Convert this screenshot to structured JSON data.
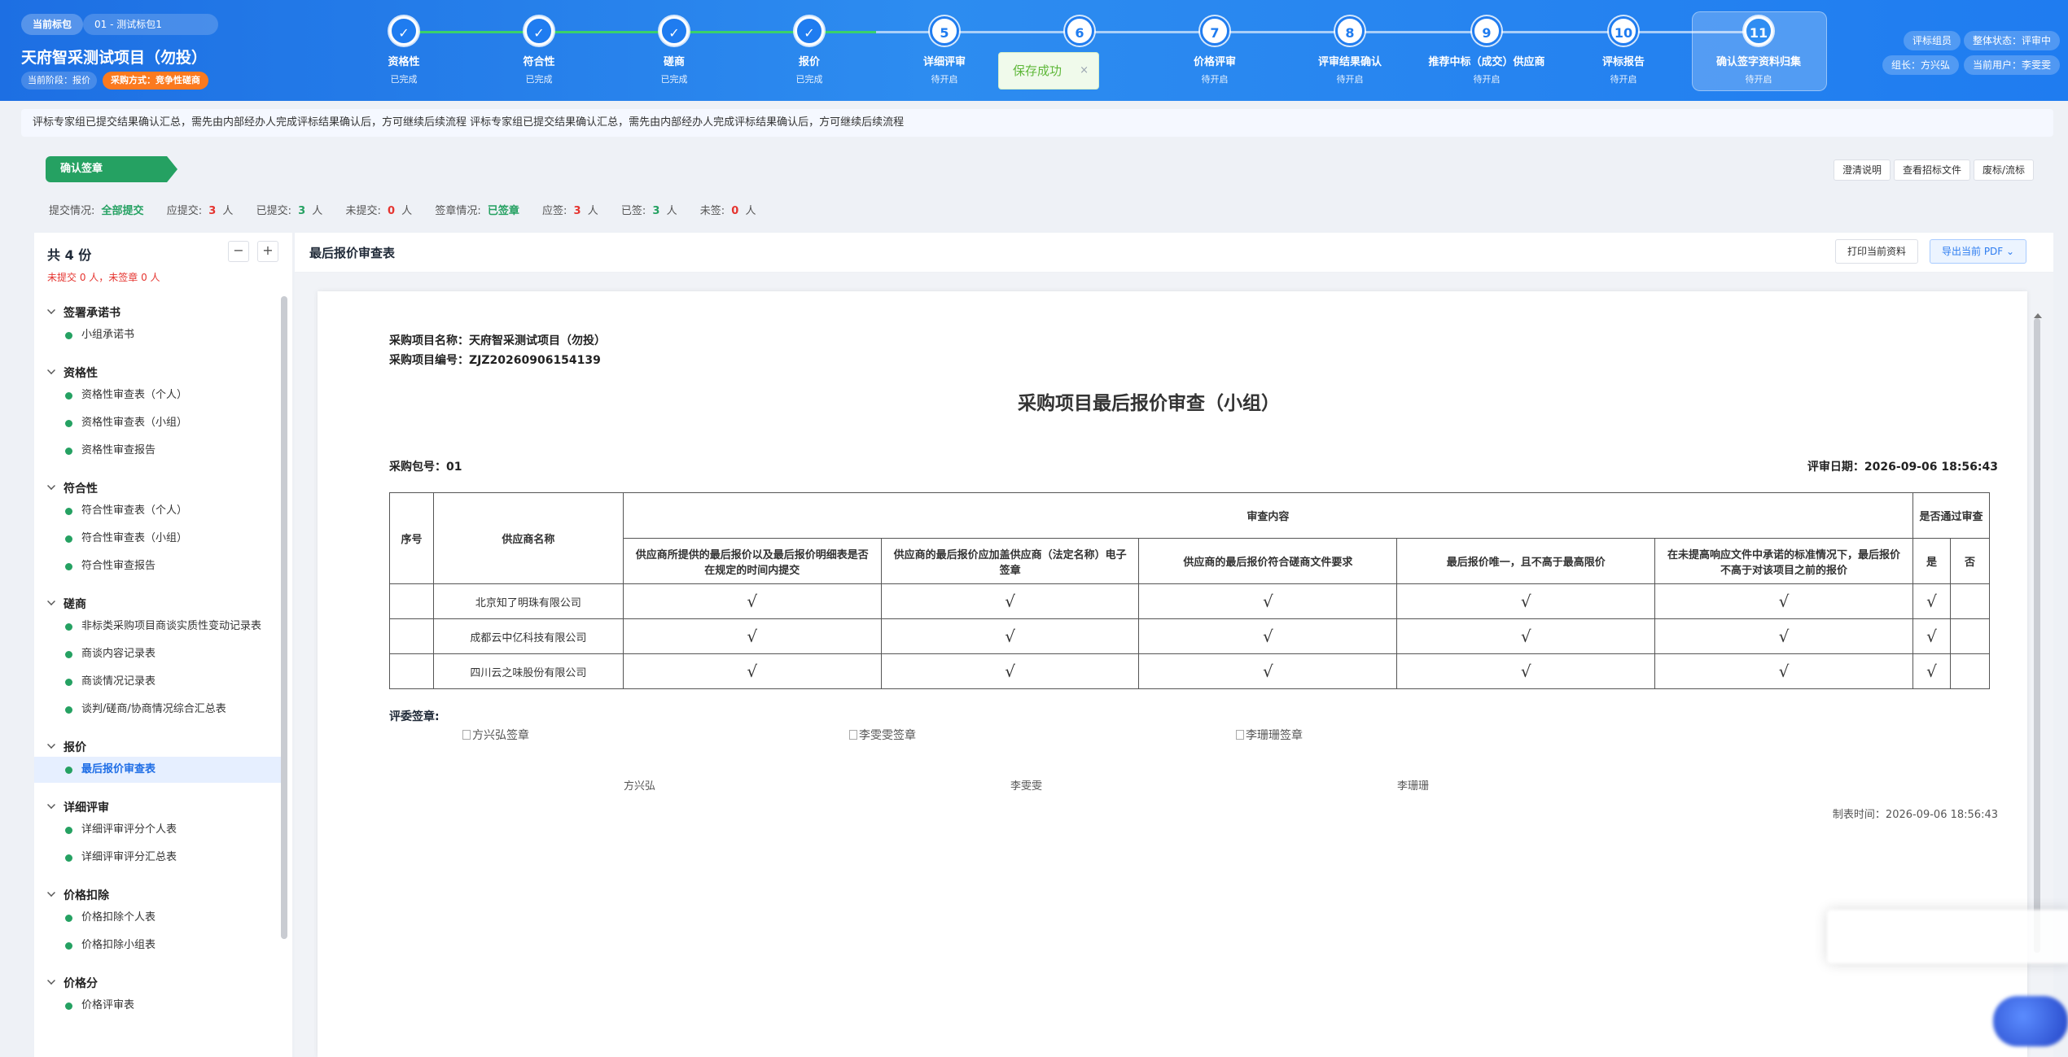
{
  "header": {
    "pkg_label": "当前标包",
    "pkg_value": "01 - 测试标包1",
    "project_title": "天府智采测试项目（勿投）",
    "stage": "当前阶段：报价",
    "method": "采购方式：竞争性磋商",
    "steps": [
      {
        "num": "✓",
        "label": "资格性",
        "status": "已完成",
        "state": "done"
      },
      {
        "num": "✓",
        "label": "符合性",
        "status": "已完成",
        "state": "done"
      },
      {
        "num": "✓",
        "label": "磋商",
        "status": "已完成",
        "state": "done"
      },
      {
        "num": "✓",
        "label": "报价",
        "status": "已完成",
        "state": "done"
      },
      {
        "num": "5",
        "label": "详细评审",
        "status": "待开启",
        "state": "todo"
      },
      {
        "num": "6",
        "label": "",
        "status": "",
        "state": "todo"
      },
      {
        "num": "7",
        "label": "价格评审",
        "status": "待开启",
        "state": "todo"
      },
      {
        "num": "8",
        "label": "评审结果确认",
        "status": "待开启",
        "state": "todo"
      },
      {
        "num": "9",
        "label": "推荐中标（成交）供应商",
        "status": "待开启",
        "state": "todo"
      },
      {
        "num": "10",
        "label": "评标报告",
        "status": "待开启",
        "state": "todo"
      },
      {
        "num": "11",
        "label": "确认签字资料归集",
        "status": "待开启",
        "state": "active"
      }
    ],
    "toast": "保存成功",
    "toast_close": "×",
    "role": "评标组员",
    "overall_status": "整体状态：评审中",
    "leader": "组长：方兴弘",
    "current_user": "当前用户：李雯雯"
  },
  "notice": "评标专家组已提交结果确认汇总，需先由内部经办人完成评标结果确认后，方可继续后续流程 评标专家组已提交结果确认汇总，需先由内部经办人完成评标结果确认后，方可继续后续流程",
  "tag": "确认签章",
  "actions": {
    "clarify": "澄清说明",
    "view_files": "查看招标文件",
    "abandon": "废标/流标"
  },
  "stats": {
    "submit_label": "提交情况:",
    "submit_value": "全部提交",
    "should_submit_label": "应提交:",
    "should_submit_num": "3",
    "submitted_label": "已提交:",
    "submitted_num": "3",
    "not_submitted_label": "未提交:",
    "not_submitted_num": "0",
    "sign_label": "签章情况:",
    "sign_value": "已签章",
    "should_sign_label": "应签:",
    "should_sign_num": "3",
    "signed_label": "已签:",
    "signed_num": "3",
    "not_signed_label": "未签:",
    "not_signed_num": "0",
    "unit": "人"
  },
  "sidebar": {
    "total": "共 4 份",
    "sub": "未提交 0 人，未签章 0 人",
    "collapse": "−",
    "expand": "+",
    "groups": [
      {
        "name": "签署承诺书",
        "items": [
          "小组承诺书"
        ]
      },
      {
        "name": "资格性",
        "items": [
          "资格性审查表（个人）",
          "资格性审查表（小组）",
          "资格性审查报告"
        ]
      },
      {
        "name": "符合性",
        "items": [
          "符合性审查表（个人）",
          "符合性审查表（小组）",
          "符合性审查报告"
        ]
      },
      {
        "name": "磋商",
        "items": [
          "非标类采购项目商谈实质性变动记录表",
          "商谈内容记录表",
          "商谈情况记录表",
          "谈判/磋商/协商情况综合汇总表"
        ]
      },
      {
        "name": "报价",
        "items": [
          "最后报价审查表"
        ]
      },
      {
        "name": "详细评审",
        "items": [
          "详细评审评分个人表",
          "详细评审评分汇总表"
        ]
      },
      {
        "name": "价格扣除",
        "items": [
          "价格扣除个人表",
          "价格扣除小组表"
        ]
      },
      {
        "name": "价格分",
        "items": [
          "价格评审表"
        ]
      }
    ]
  },
  "main": {
    "title": "最后报价审查表",
    "print": "打印当前资料",
    "export": "导出当前 PDF"
  },
  "doc": {
    "project_name": "采购项目名称：天府智采测试项目（勿投）",
    "project_no": "采购项目编号：ZJZ20260906154139",
    "title": "采购项目最后报价审查（小组）",
    "pkg": "采购包号：01",
    "date": "评审日期：2026-09-06 18:56:43",
    "table": {
      "col_no": "序号",
      "col_supplier": "供应商名称",
      "col_content": "审查内容",
      "col_pass": "是否通过审查",
      "criteria": [
        "供应商所提供的最后报价以及最后报价明细表是否在规定的时间内提交",
        "供应商的最后报价应加盖供应商（法定名称）电子签章",
        "供应商的最后报价符合磋商文件要求",
        "最后报价唯一，且不高于最高限价",
        "在未提高响应文件中承诺的标准情况下，最后报价不高于对该项目之前的报价"
      ],
      "yes": "是",
      "no": "否",
      "rows": [
        {
          "no": "",
          "supplier": "北京知了明珠有限公司",
          "marks": [
            "√",
            "√",
            "√",
            "√",
            "√"
          ],
          "yes": "√"
        },
        {
          "no": "",
          "supplier": "成都云中亿科技有限公司",
          "marks": [
            "√",
            "√",
            "√",
            "√",
            "√"
          ],
          "yes": "√"
        },
        {
          "no": "",
          "supplier": "四川云之味股份有限公司",
          "marks": [
            "√",
            "√",
            "√",
            "√",
            "√"
          ],
          "yes": "√"
        }
      ]
    },
    "sig_label": "评委签章:",
    "signatures": [
      {
        "img_alt": "方兴弘签章",
        "name": "方兴弘"
      },
      {
        "img_alt": "李雯雯签章",
        "name": "李雯雯"
      },
      {
        "img_alt": "李珊珊签章",
        "name": "李珊珊"
      }
    ],
    "made_time": "制表时间：2026-09-06 18:56:43"
  }
}
